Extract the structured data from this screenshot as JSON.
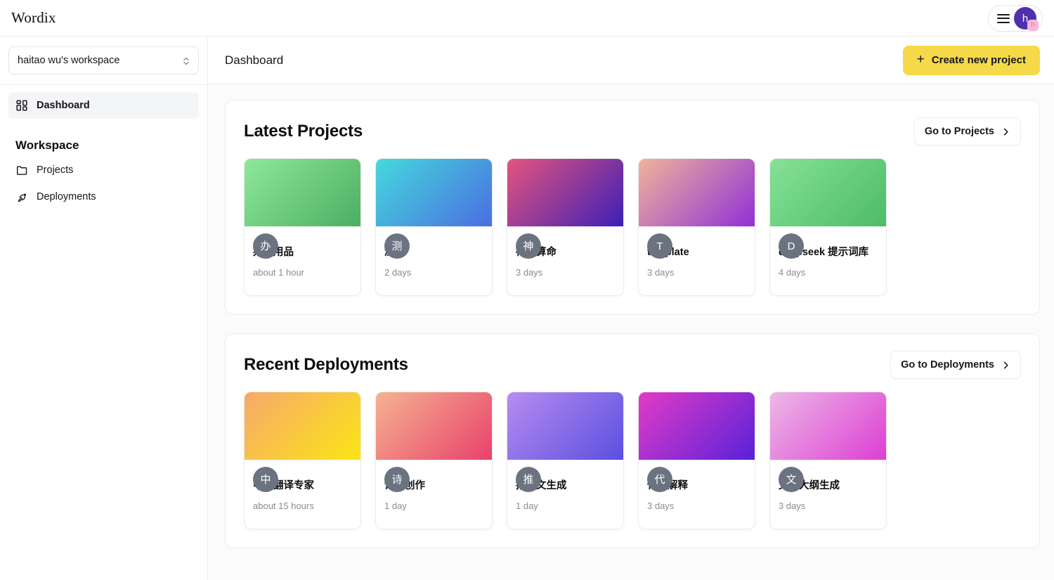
{
  "app": {
    "logo": "Wordix"
  },
  "topbar": {
    "menu_icon": "hamburger-menu-icon",
    "avatar_initial": "h",
    "avatar_badge_initial": "h",
    "avatar_color": "#4f30ad",
    "avatar_badge_color": "#f6b8d6"
  },
  "sidebar": {
    "workspace_selector": {
      "value": "haitao wu's workspace",
      "icon": "chevron-up-down-icon"
    },
    "items": [
      {
        "label": "Dashboard",
        "icon": "grid-icon",
        "active": true
      }
    ],
    "section_title": "Workspace",
    "group_items": [
      {
        "label": "Projects",
        "icon": "folder-icon",
        "active": false
      },
      {
        "label": "Deployments",
        "icon": "rocket-icon",
        "active": false
      }
    ]
  },
  "main": {
    "page_title": "Dashboard",
    "create_button": {
      "label": "Create new project",
      "icon": "plus-icon",
      "color": "#f5d948"
    },
    "panels": [
      {
        "title": "Latest Projects",
        "action_label": "Go to Projects",
        "action_icon": "chevron-right-icon",
        "cards": [
          {
            "avatar": "办",
            "title": "办公用品",
            "time": "about 1 hour",
            "gradient_from": "#8ee89a",
            "gradient_to": "#4cae63"
          },
          {
            "avatar": "测",
            "title": "测试",
            "time": "2 days",
            "gradient_from": "#45d9dd",
            "gradient_to": "#4a6ee0"
          },
          {
            "avatar": "神",
            "title": "神棍算命",
            "time": "3 days",
            "gradient_from": "#e4547e",
            "gradient_to": "#3d1fb5"
          },
          {
            "avatar": "T",
            "title": "template",
            "time": "3 days",
            "gradient_from": "#f0b49a",
            "gradient_to": "#9130d8"
          },
          {
            "avatar": "D",
            "title": "deepseek 提示词库",
            "time": "4 days",
            "gradient_from": "#86e196",
            "gradient_to": "#4cbc68"
          }
        ]
      },
      {
        "title": "Recent Deployments",
        "action_label": "Go to Deployments",
        "action_icon": "chevron-right-icon",
        "cards": [
          {
            "avatar": "中",
            "title": "中英翻译专家",
            "time": "about 15 hours",
            "gradient_from": "#f6a96b",
            "gradient_to": "#fbe516"
          },
          {
            "avatar": "诗",
            "title": "诗歌创作",
            "time": "1 day",
            "gradient_from": "#f6b391",
            "gradient_to": "#e8416b"
          },
          {
            "avatar": "推",
            "title": "推广文生成",
            "time": "1 day",
            "gradient_from": "#b68cf0",
            "gradient_to": "#5b4fe0"
          },
          {
            "avatar": "代",
            "title": "代码解释",
            "time": "3 days",
            "gradient_from": "#e13bc8",
            "gradient_to": "#5a21d8"
          },
          {
            "avatar": "文",
            "title": "文案大纲生成",
            "time": "3 days",
            "gradient_from": "#edb8e6",
            "gradient_to": "#dc3fd4"
          }
        ]
      }
    ]
  }
}
